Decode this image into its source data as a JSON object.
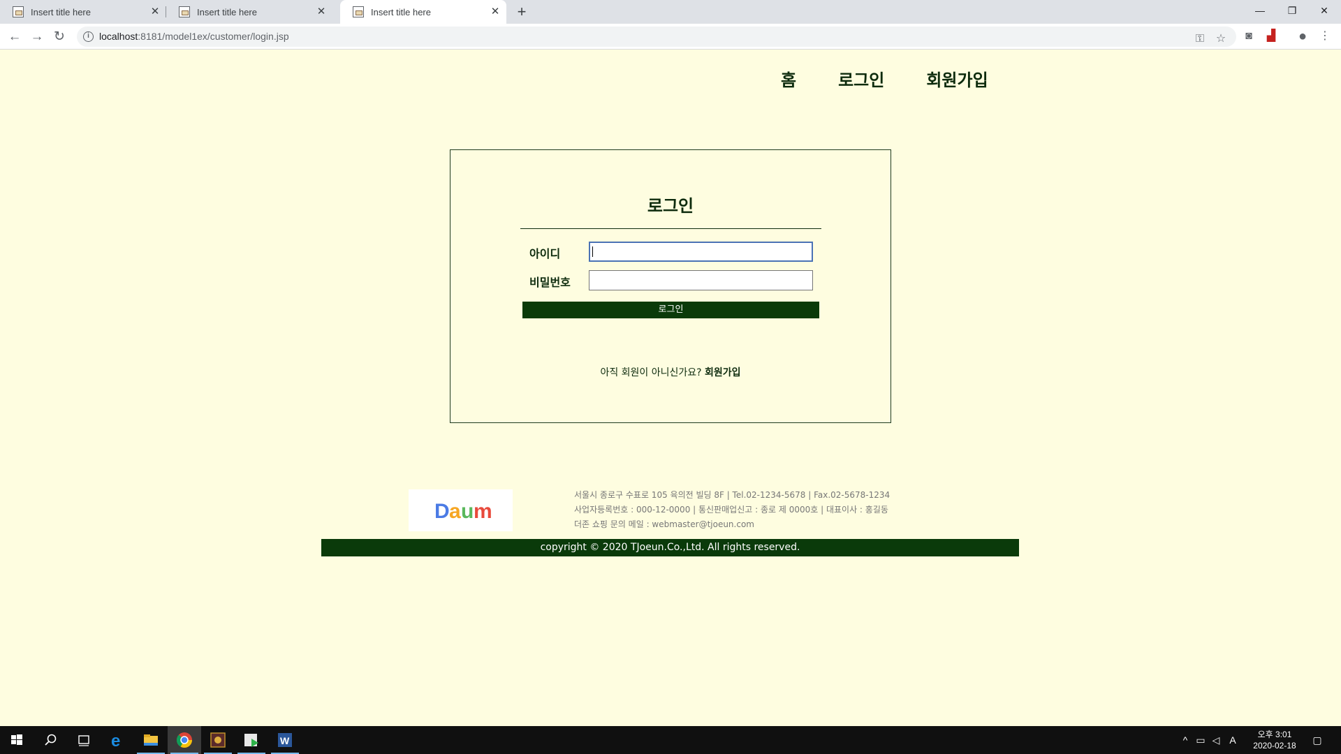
{
  "browser": {
    "tabs": [
      {
        "title": "Insert title here",
        "active": false
      },
      {
        "title": "Insert title here",
        "active": false
      },
      {
        "title": "Insert title here",
        "active": true
      }
    ],
    "url_host": "localhost",
    "url_rest": ":8181/model1ex/customer/login.jsp",
    "icons": [
      "back-arrow-icon",
      "forward-arrow-icon",
      "reload-icon",
      "info-icon",
      "key-icon",
      "star-icon",
      "camera-icon",
      "pdf-icon",
      "account-icon",
      "menu-icon"
    ]
  },
  "nav": {
    "home": "홈",
    "login": "로그인",
    "join": "회원가입"
  },
  "login_form": {
    "title": "로그인",
    "id_label": "아이디",
    "id_value": "",
    "pw_label": "비밀번호",
    "pw_value": "",
    "submit": "로그인",
    "signup_prompt": "아직 회원이 아니신가요?",
    "signup_link": "회원가입"
  },
  "footer": {
    "logo_text": "Daum",
    "address": "서울시 종로구 수표로 105 육의전 빌딩 8F | Tel.02-1234-5678 | Fax.02-5678-1234",
    "business": "사업자등록번호 : 000-12-0000 | 통신판매업신고 : 종로 제 0000호 | 대표이사 : 홍길동",
    "email": "더존 쇼핑 문의 메일 : webmaster@tjoeun.com",
    "copyright": "copyright © 2020 TJoeun.Co.,Ltd. All rights reserved."
  },
  "taskbar": {
    "clock_time": "오후 3:01",
    "clock_date": "2020-02-18",
    "ime": "A"
  },
  "colors": {
    "page_bg": "#fefde0",
    "dark_green": "#0a3a0a",
    "text_green": "#0d2b0d"
  }
}
